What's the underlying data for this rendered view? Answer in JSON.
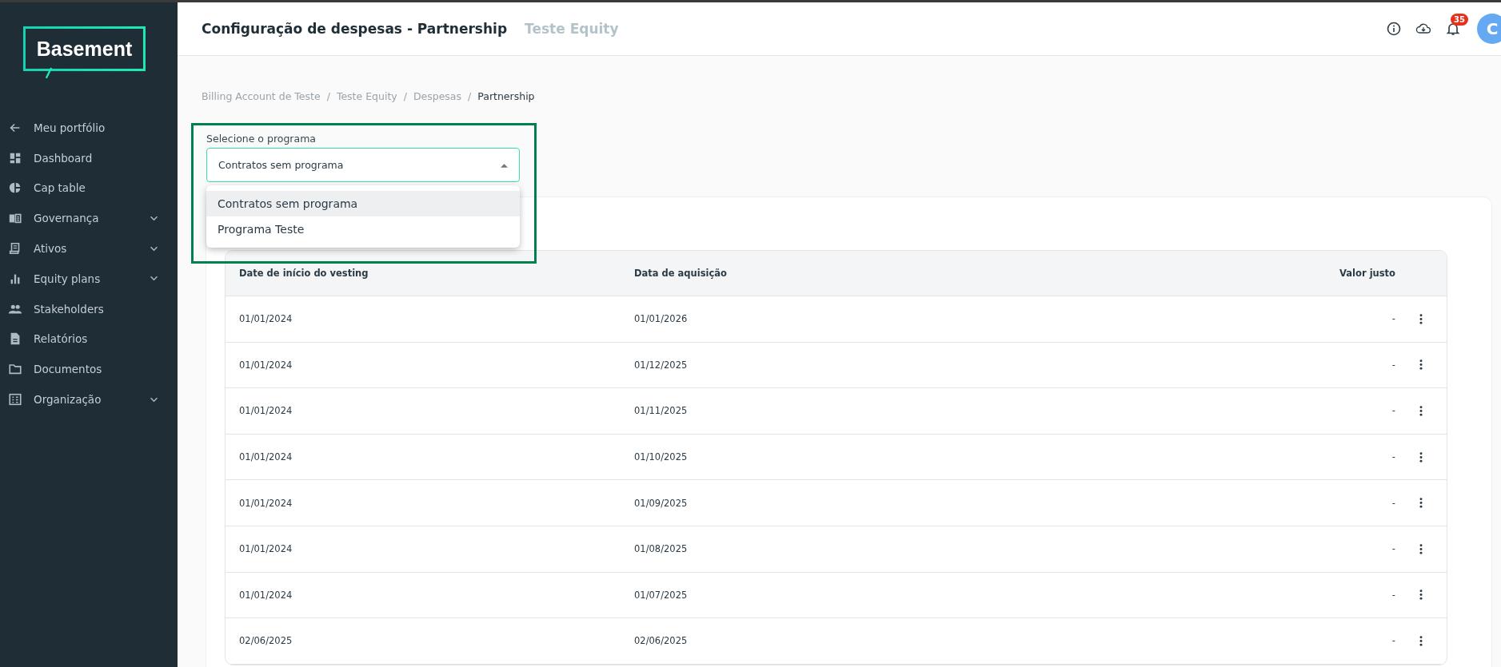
{
  "sidebar": {
    "logo": "Basement",
    "items": [
      {
        "label": "Meu portfólio",
        "kind": "back",
        "expandable": false
      },
      {
        "label": "Dashboard",
        "kind": "dashboard",
        "expandable": false
      },
      {
        "label": "Cap table",
        "kind": "pie",
        "expandable": false
      },
      {
        "label": "Governança",
        "kind": "book",
        "expandable": true
      },
      {
        "label": "Ativos",
        "kind": "receipt",
        "expandable": true
      },
      {
        "label": "Equity plans",
        "kind": "bars",
        "expandable": true
      },
      {
        "label": "Stakeholders",
        "kind": "people",
        "expandable": false
      },
      {
        "label": "Relatórios",
        "kind": "doc",
        "expandable": false
      },
      {
        "label": "Documentos",
        "kind": "folder",
        "expandable": false
      },
      {
        "label": "Organização",
        "kind": "building",
        "expandable": true
      }
    ]
  },
  "header": {
    "title": "Configuração de despesas - Partnership",
    "subtitle": "Teste Equity",
    "notification_count": "35",
    "avatar_initial": "C"
  },
  "breadcrumb": [
    {
      "label": "Billing Account de Teste",
      "current": false
    },
    {
      "separator": "/",
      "label": "Teste Equity",
      "current": false
    },
    {
      "separator": "/",
      "label": "Despesas",
      "current": false
    },
    {
      "separator": "/",
      "label": "Partnership",
      "current": true
    }
  ],
  "program_select": {
    "label": "Selecione o programa",
    "value": "Contratos sem programa",
    "expanded": true,
    "options": [
      {
        "label": "Contratos sem programa",
        "selected": true
      },
      {
        "label": "Programa Teste",
        "selected": false
      }
    ]
  },
  "table": {
    "columns": [
      "Date de início do vesting",
      "Data de aquisição",
      "Valor justo"
    ],
    "rows": [
      {
        "cells": [
          "01/01/2024",
          "01/01/2026",
          "-"
        ]
      },
      {
        "cells": [
          "01/01/2024",
          "01/12/2025",
          "-"
        ]
      },
      {
        "cells": [
          "01/01/2024",
          "01/11/2025",
          "-"
        ]
      },
      {
        "cells": [
          "01/01/2024",
          "01/10/2025",
          "-"
        ]
      },
      {
        "cells": [
          "01/01/2024",
          "01/09/2025",
          "-"
        ]
      },
      {
        "cells": [
          "01/01/2024",
          "01/08/2025",
          "-"
        ]
      },
      {
        "cells": [
          "01/01/2024",
          "01/07/2025",
          "-"
        ]
      },
      {
        "cells": [
          "02/06/2025",
          "02/06/2025",
          "-"
        ]
      }
    ]
  }
}
